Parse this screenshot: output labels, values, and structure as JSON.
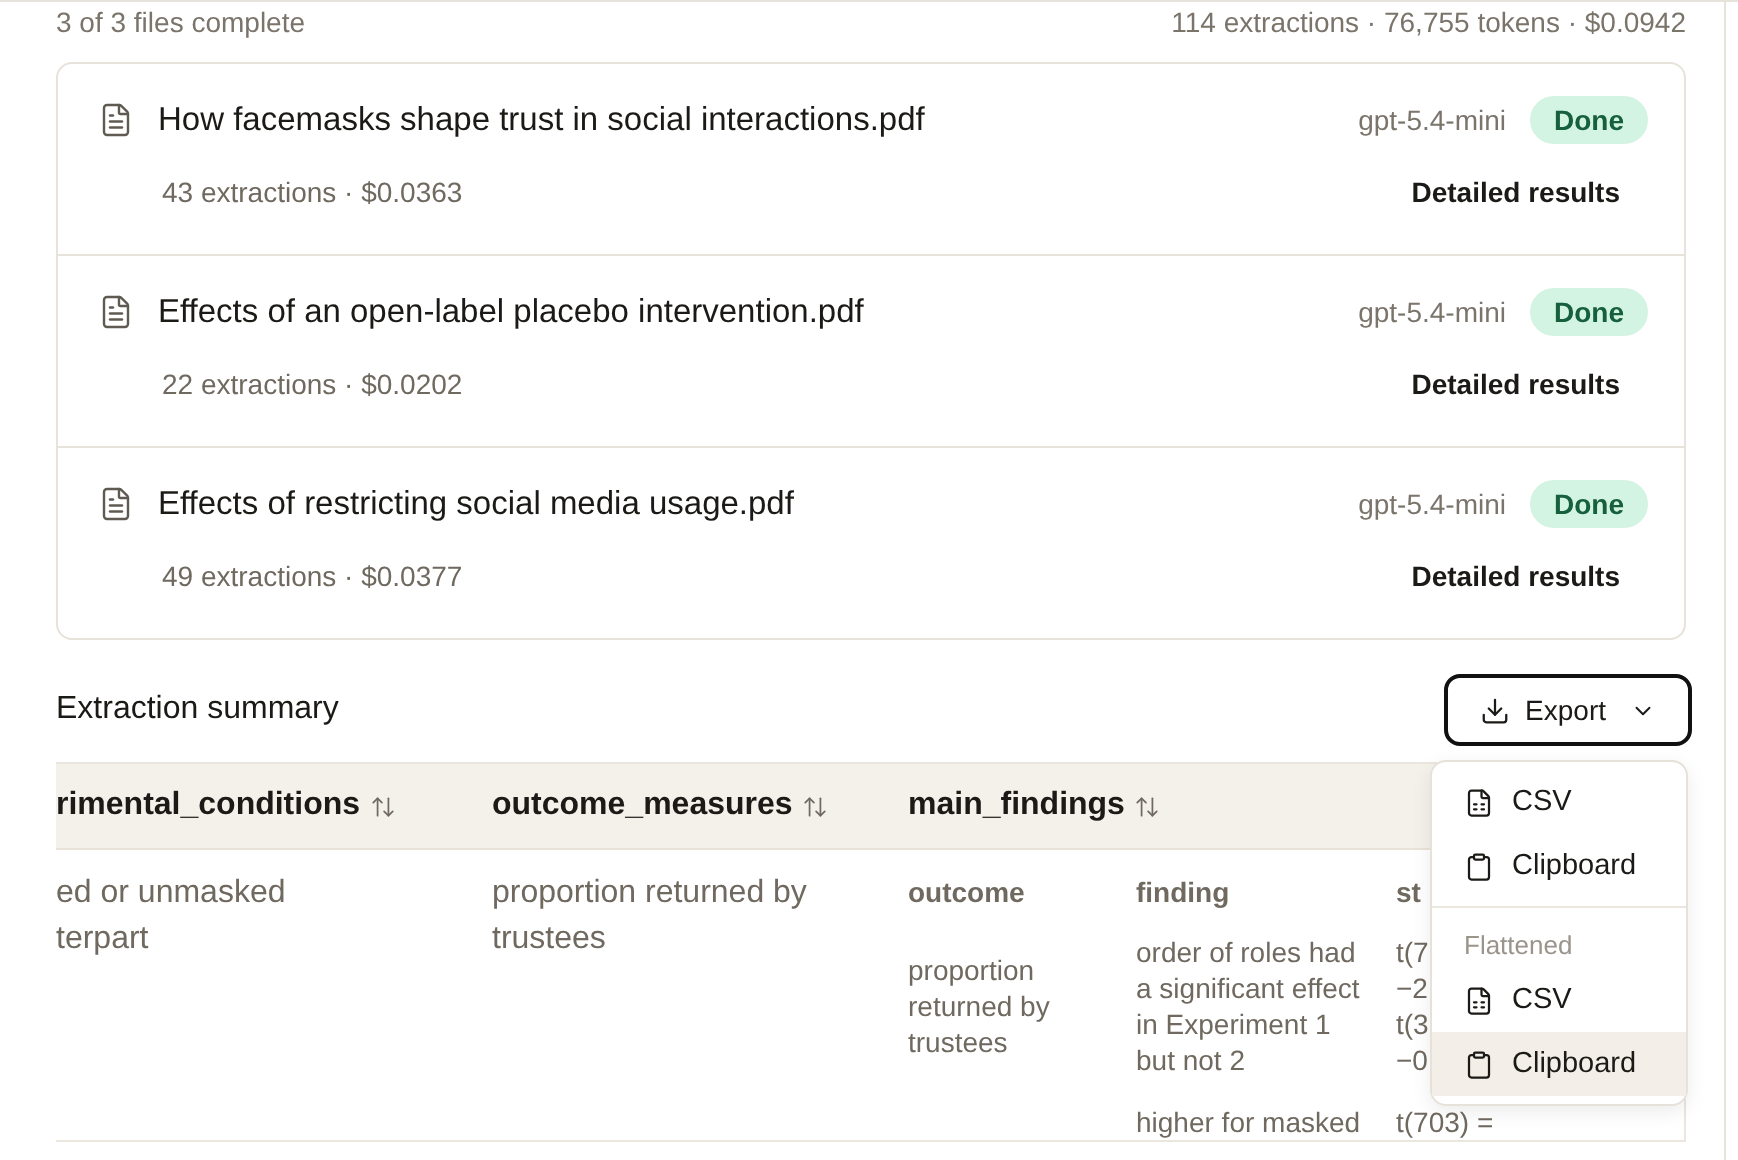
{
  "progress": {
    "files_complete": "3 of 3 files complete",
    "totals": "114 extractions · 76,755 tokens · $0.0942"
  },
  "files": [
    {
      "name": "How facemasks shape trust in social interactions.pdf",
      "model": "gpt-5.4-mini",
      "status": {
        "label": "Done",
        "kind": "done"
      },
      "meta": "43 extractions · $0.0363",
      "link": "Detailed results"
    },
    {
      "name": "Effects of an open-label placebo intervention.pdf",
      "model": "gpt-5.4-mini",
      "status": {
        "label": "Done",
        "kind": "done"
      },
      "meta": "22 extractions · $0.0202",
      "link": "Detailed results"
    },
    {
      "name": "Effects of restricting social media usage.pdf",
      "model": "gpt-5.4-mini",
      "status": {
        "label": "Done",
        "kind": "done"
      },
      "meta": "49 extractions · $0.0377",
      "link": "Detailed results"
    }
  ],
  "summary": {
    "title": "Extraction summary",
    "export_button": "Export",
    "export_menu": {
      "items": [
        {
          "label": "CSV",
          "kind": "csv",
          "selected": false
        },
        {
          "label": "Clipboard",
          "kind": "clipboard",
          "selected": false
        }
      ],
      "group_label": "Flattened",
      "flattened_items": [
        {
          "label": "CSV",
          "kind": "csv",
          "selected": false
        },
        {
          "label": "Clipboard",
          "kind": "clipboard",
          "selected": true
        }
      ]
    }
  },
  "table": {
    "columns": [
      "rimental_conditions",
      "outcome_measures",
      "main_findings"
    ],
    "rows": [
      {
        "cells": [
          "ed or unmasked terpart",
          "proportion returned by trustees"
        ],
        "findings": {
          "columns": [
            "outcome",
            "finding",
            "st"
          ],
          "rows": [
            {
              "outcome": "proportion returned by trustees",
              "finding": "order of roles had a significant effect in Experiment 1 but not 2",
              "statistic": [
                "t(7",
                "−2",
                "t(3",
                "−0"
              ]
            },
            {
              "finding": "higher for masked",
              "statistic": [
                "t(703) ="
              ]
            }
          ]
        }
      }
    ]
  }
}
